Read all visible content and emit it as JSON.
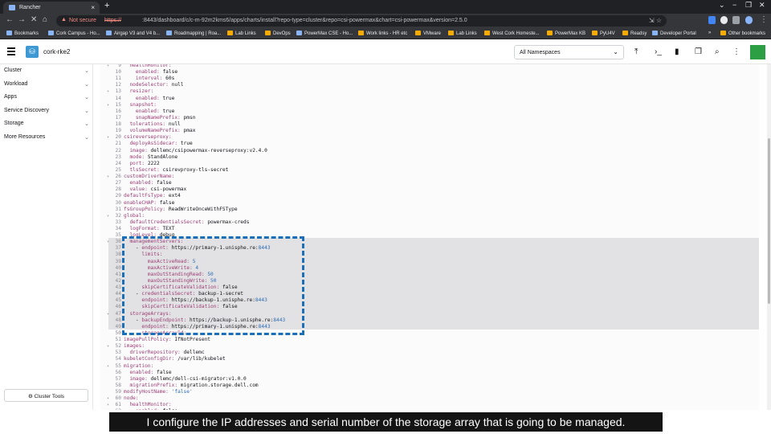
{
  "browser": {
    "tab_title": "Rancher",
    "tab_close": "×",
    "new_tab": "+",
    "security_label": "Not secure",
    "url_scheme": "https://",
    "url_rest": ":8443/dashboard/c/c-m-92m2kms6/apps/charts/install?repo-type=cluster&repo=csi-powermax&chart=csi-powermax&version=2.5.0",
    "bookmarks": [
      "Bookmarks",
      "Cork Campus - Ho...",
      "Airgap V3 and V4 b...",
      "Roadmapping | Roa...",
      "Lab Links",
      "DevOps",
      "PowerMax CSE - Ho...",
      "Work links - HR etc",
      "VMware",
      "Lab Links",
      "West Cork Homeste...",
      "PowerMax KB",
      "PyU4V",
      "Readsy",
      "Developer Portal"
    ],
    "more_bookmarks": "»",
    "other_bookmarks": "Other bookmarks"
  },
  "header": {
    "cluster_name": "cork-rke2",
    "namespace_selected": "All Namespaces"
  },
  "sidebar": {
    "items": [
      {
        "label": "Cluster"
      },
      {
        "label": "Workload"
      },
      {
        "label": "Apps"
      },
      {
        "label": "Service Discovery"
      },
      {
        "label": "Storage"
      },
      {
        "label": "More Resources"
      }
    ],
    "cluster_tools": "Cluster Tools"
  },
  "editor": {
    "lines": [
      {
        "n": "9",
        "fold": true,
        "indent": "  ",
        "key": "healthMonitor:",
        "val": ""
      },
      {
        "n": "10",
        "indent": "    ",
        "key": "enabled:",
        "val": " false"
      },
      {
        "n": "11",
        "indent": "    ",
        "key": "interval:",
        "val": " 60s"
      },
      {
        "n": "12",
        "indent": "  ",
        "key": "nodeSelector:",
        "val": " null"
      },
      {
        "n": "13",
        "fold": true,
        "indent": "  ",
        "key": "resizer:",
        "val": ""
      },
      {
        "n": "14",
        "indent": "    ",
        "key": "enabled:",
        "val": " true"
      },
      {
        "n": "15",
        "fold": true,
        "indent": "  ",
        "key": "snapshot:",
        "val": ""
      },
      {
        "n": "16",
        "indent": "    ",
        "key": "enabled:",
        "val": " true"
      },
      {
        "n": "17",
        "indent": "    ",
        "key": "snapNamePrefix:",
        "val": " pmsn"
      },
      {
        "n": "18",
        "indent": "  ",
        "key": "tolerations:",
        "val": " null"
      },
      {
        "n": "19",
        "indent": "  ",
        "key": "volumeNamePrefix:",
        "val": " pmax"
      },
      {
        "n": "20",
        "fold": true,
        "indent": "",
        "key": "csireverseproxy:",
        "val": ""
      },
      {
        "n": "21",
        "indent": "  ",
        "key": "deployAsSidecar:",
        "val": " true"
      },
      {
        "n": "22",
        "indent": "  ",
        "key": "image:",
        "val": " dellemc/csipowermax-reverseproxy:v2.4.0"
      },
      {
        "n": "23",
        "indent": "  ",
        "key": "mode:",
        "val": " StandAlone"
      },
      {
        "n": "24",
        "indent": "  ",
        "key": "port:",
        "val": " 2222"
      },
      {
        "n": "25",
        "indent": "  ",
        "key": "tlsSecret:",
        "val": " csirevproxy-tls-secret"
      },
      {
        "n": "26",
        "fold": true,
        "indent": "",
        "key": "customDriverName:",
        "val": ""
      },
      {
        "n": "27",
        "indent": "  ",
        "key": "enabled:",
        "val": " false"
      },
      {
        "n": "28",
        "indent": "  ",
        "key": "value:",
        "val": " csi-powermax"
      },
      {
        "n": "29",
        "indent": "",
        "key": "defaultFsType:",
        "val": " ext4"
      },
      {
        "n": "30",
        "indent": "",
        "key": "enableCHAP:",
        "val": " false"
      },
      {
        "n": "31",
        "indent": "",
        "key": "fsGroupPolicy:",
        "val": " ReadWriteOnceWithFSType"
      },
      {
        "n": "32",
        "fold": true,
        "indent": "",
        "key": "global:",
        "val": ""
      },
      {
        "n": "33",
        "indent": "  ",
        "key": "defaultCredentialsSecret:",
        "val": " powermax-creds"
      },
      {
        "n": "34",
        "indent": "  ",
        "key": "logFormat:",
        "val": " TEXT"
      },
      {
        "n": "35",
        "indent": "  ",
        "key": "logLevel:",
        "val": " debug"
      },
      {
        "n": "36",
        "fold": true,
        "indent": "  ",
        "key": "managementServers:",
        "val": ""
      },
      {
        "n": "37",
        "indent": "    - ",
        "key": "endpoint:",
        "val": " https://primary-1.unisphe.re:",
        "num": "8443"
      },
      {
        "n": "38",
        "indent": "      ",
        "key": "limits:",
        "val": ""
      },
      {
        "n": "39",
        "indent": "        ",
        "key": "maxActiveRead:",
        "val": "",
        "num": " 5"
      },
      {
        "n": "40",
        "indent": "        ",
        "key": "maxActiveWrite:",
        "val": "",
        "num": " 4"
      },
      {
        "n": "41",
        "indent": "        ",
        "key": "maxOutStandingRead:",
        "val": "",
        "num": " 50"
      },
      {
        "n": "42",
        "indent": "        ",
        "key": "maxOutStandingWrite:",
        "val": "",
        "num": " 50"
      },
      {
        "n": "43",
        "indent": "      ",
        "key": "skipCertificateValidation:",
        "val": " false"
      },
      {
        "n": "44",
        "indent": "    - ",
        "key": "credentialsSecret:",
        "val": " backup-1-secret"
      },
      {
        "n": "45",
        "indent": "      ",
        "key": "endpoint:",
        "val": " https://backup-1.unisphe.re:",
        "num": "8443"
      },
      {
        "n": "46",
        "indent": "      ",
        "key": "skipCertificateValidation:",
        "val": " false"
      },
      {
        "n": "47",
        "fold": true,
        "indent": "  ",
        "key": "storageArrays:",
        "val": ""
      },
      {
        "n": "48",
        "indent": "    - ",
        "key": "backupEndpoint:",
        "val": " https://backup-1.unisphe.re:",
        "num": "8443"
      },
      {
        "n": "49",
        "indent": "      ",
        "key": "endpoint:",
        "val": " https://primary-1.unisphe.re:",
        "num": "8443"
      },
      {
        "n": "50",
        "indent": "      ",
        "key": "storageArrayId:",
        "val": ""
      },
      {
        "n": "51",
        "indent": "",
        "key": "imagePullPolicy:",
        "val": " IfNotPresent"
      },
      {
        "n": "52",
        "fold": true,
        "indent": "",
        "key": "images:",
        "val": ""
      },
      {
        "n": "53",
        "indent": "  ",
        "key": "driverRepository:",
        "val": " dellemc"
      },
      {
        "n": "54",
        "indent": "",
        "key": "kubeletConfigDir:",
        "val": " /var/lib/kubelet"
      },
      {
        "n": "55",
        "fold": true,
        "indent": "",
        "key": "migration:",
        "val": ""
      },
      {
        "n": "56",
        "indent": "  ",
        "key": "enabled:",
        "val": " false"
      },
      {
        "n": "57",
        "indent": "  ",
        "key": "image:",
        "val": " dellemc/dell-csi-migrator:v1.0.0"
      },
      {
        "n": "58",
        "indent": "  ",
        "key": "migrationPrefix:",
        "val": " migration.storage.dell.com"
      },
      {
        "n": "59",
        "indent": "",
        "key": "modifyHostName:",
        "val": "",
        "num": " 'false'"
      },
      {
        "n": "60",
        "fold": true,
        "indent": "",
        "key": "node:",
        "val": ""
      },
      {
        "n": "61",
        "fold": true,
        "indent": "  ",
        "key": "healthMonitor:",
        "val": ""
      },
      {
        "n": "62",
        "indent": "    ",
        "key": "enabled:",
        "val": " false"
      }
    ]
  },
  "caption": "I configure the IP addresses and serial number of the storage array that is going to be managed.",
  "colors": {
    "accent": "#3d98d3",
    "highlight_box": "#1b6fb8",
    "yaml_key": "#9b3e76",
    "rancher_green": "#2c9f45"
  }
}
